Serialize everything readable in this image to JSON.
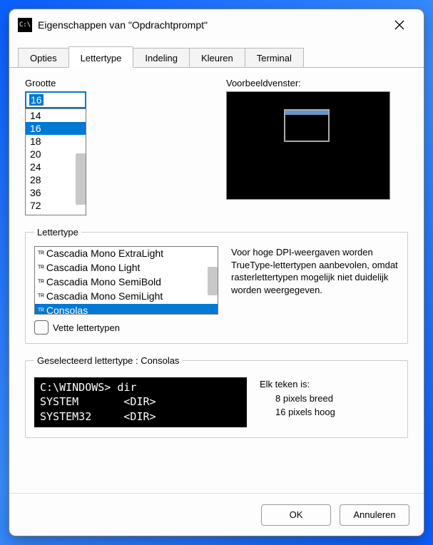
{
  "titlebar": {
    "icon_text": "C:\\",
    "title": "Eigenschappen van \"Opdrachtprompt\""
  },
  "tabs": [
    {
      "label": "Opties"
    },
    {
      "label": "Lettertype"
    },
    {
      "label": "Indeling"
    },
    {
      "label": "Kleuren"
    },
    {
      "label": "Terminal"
    }
  ],
  "active_tab": "Lettertype",
  "size_group": {
    "label": "Grootte",
    "current": "16",
    "options": [
      "14",
      "16",
      "18",
      "20",
      "24",
      "28",
      "36",
      "72"
    ],
    "selected": "16"
  },
  "preview": {
    "label": "Voorbeeldvenster:"
  },
  "font_group": {
    "label": "Lettertype",
    "options": [
      "Cascadia Mono ExtraLight",
      "Cascadia Mono Light",
      "Cascadia Mono SemiBold",
      "Cascadia Mono SemiLight",
      "Consolas"
    ],
    "selected": "Consolas",
    "dpi_help": "Voor hoge DPI-weergaven worden TrueType-lettertypen aanbevolen, omdat rasterlettertypen mogelijk niet duidelijk worden weergegeven.",
    "bold_label": "Vette lettertypen",
    "bold_checked": false
  },
  "selected_group": {
    "label": "Geselecteerd lettertype : Consolas",
    "terminal_lines": [
      "C:\\WINDOWS> dir",
      "SYSTEM       <DIR>",
      "SYSTEM32     <DIR>"
    ],
    "char_title": "Elk teken is:",
    "char_width": "8 pixels breed",
    "char_height": "16 pixels hoog"
  },
  "footer": {
    "ok": "OK",
    "cancel": "Annuleren"
  }
}
